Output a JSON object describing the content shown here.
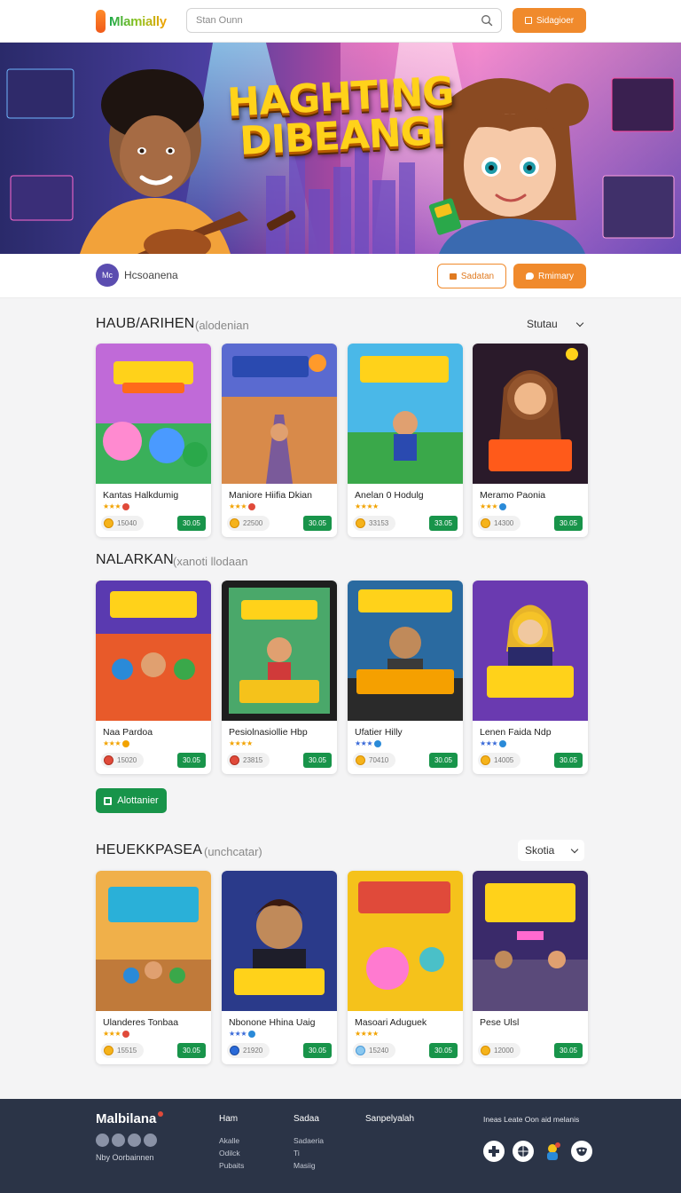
{
  "header": {
    "logo_text": "Mlamially",
    "search_placeholder": "Stan Ounn",
    "action_label": "Sidagioer"
  },
  "hero": {
    "title_line1": "HAGHTING",
    "title_line2": "DIBEANGI"
  },
  "profile": {
    "avatar_initials": "Mc",
    "name": "Hcsoanena",
    "outline_button": "Sadatan",
    "solid_button": "Rmimary"
  },
  "sections": [
    {
      "title": "HAUB/ARIHEN",
      "subtitle": "(alodenian",
      "sort_label": "Stutau",
      "cards": [
        {
          "title": "Kantas Halkdumig",
          "price": "15040",
          "buy": "30.05",
          "rating": 3,
          "badge_color": "#e04a3a"
        },
        {
          "title": "Maniore Hiifia Dkian",
          "price": "22500",
          "buy": "30.05",
          "rating": 3,
          "badge_color": "#e04a3a"
        },
        {
          "title": "Anelan 0 Hodulg",
          "price": "33153",
          "buy": "33.05",
          "rating": 4,
          "badge_color": "#f2a300"
        },
        {
          "title": "Meramo Paonia",
          "price": "14300",
          "buy": "30.05",
          "rating": 3,
          "badge_color": "#2a8ad8"
        }
      ]
    },
    {
      "title": "NALARKAN",
      "subtitle": "(xanoti llodaan",
      "sort_label": "",
      "cards": [
        {
          "title": "Naa Pardoa",
          "price": "15020",
          "buy": "30.05",
          "rating": 3,
          "badge_color": "#f2a300"
        },
        {
          "title": "Pesiolnasiollie Hbp",
          "price": "23815",
          "buy": "30.05",
          "rating": 4,
          "badge_color": "#e04a3a"
        },
        {
          "title": "Ufatier Hilly",
          "price": "70410",
          "buy": "30.05",
          "rating": 3,
          "badge_color": "#2a8ad8"
        },
        {
          "title": "Lenen Faida Ndp",
          "price": "14005",
          "buy": "30.05",
          "rating": 3,
          "badge_color": "#2a8ad8"
        }
      ]
    },
    {
      "title": "HEUEKKPASEA",
      "subtitle": "(unchcatar)",
      "sort_label": "Skotia",
      "cards": [
        {
          "title": "Ulanderes Tonbaa",
          "price": "15515",
          "buy": "30.05",
          "rating": 3,
          "badge_color": "#e04a3a"
        },
        {
          "title": "Nbonone Hhina Uaig",
          "price": "21920",
          "buy": "30.05",
          "rating": 3,
          "badge_color": "#2a8ad8"
        },
        {
          "title": "Masoari Aduguek",
          "price": "15240",
          "buy": "30.05",
          "rating": 4,
          "badge_color": "#e04a3a"
        },
        {
          "title": "Pese Ulsl",
          "price": "12000",
          "buy": "30.05",
          "rating": 0,
          "badge_color": ""
        }
      ]
    }
  ],
  "section2_button": "Alottanier",
  "footer": {
    "brand": "Malbilana",
    "tagline": "Nby Oorbainnen",
    "columns": [
      {
        "heading": "Ham",
        "links": [
          "Akalle",
          "Odilck",
          "Pubaits"
        ]
      },
      {
        "heading": "Sadaa",
        "links": [
          "Sadaeria",
          "Ti",
          "Masiig"
        ]
      },
      {
        "heading": "Sanpelyalah",
        "links": []
      }
    ],
    "right_text": "Ineas Leate Oon aid melanis",
    "app_icons": [
      "plus-icon",
      "grid-icon",
      "character-icon",
      "mask-icon"
    ]
  }
}
